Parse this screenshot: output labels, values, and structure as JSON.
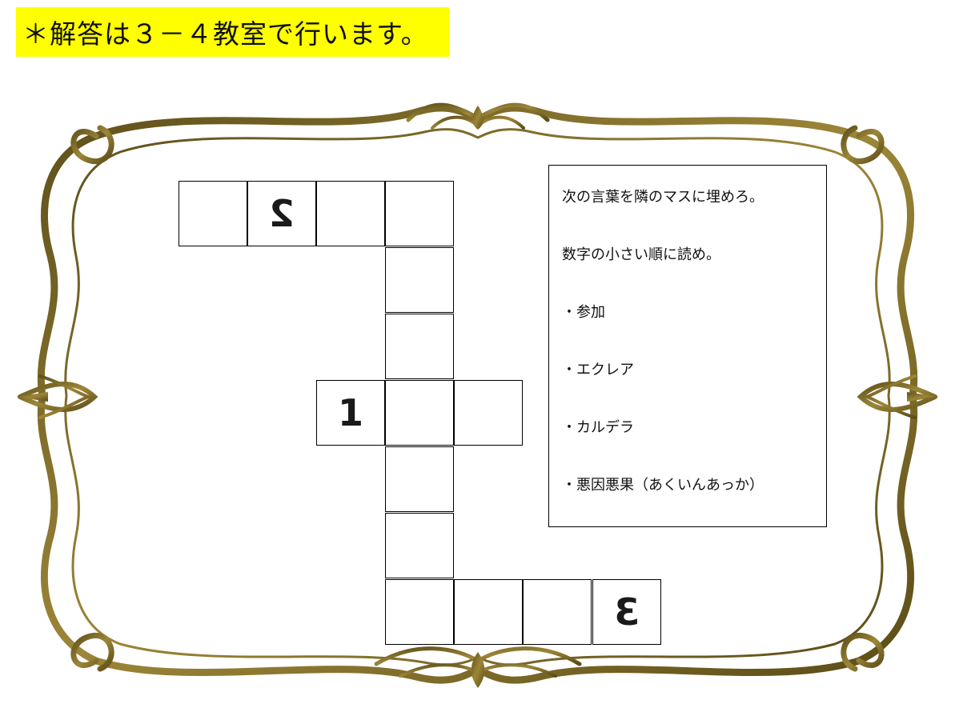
{
  "banner": {
    "text": "＊解答は３－４教室で行います。"
  },
  "frame": {
    "color": "#7a6722",
    "highlight": "#c9b35a"
  },
  "puzzle": {
    "clue_numbers": {
      "one": "1",
      "two": "2",
      "three": "3"
    }
  },
  "clues": {
    "instruction_1": "次の言葉を隣のマスに埋めろ。",
    "instruction_2": "数字の小さい順に読め。",
    "items": [
      "・参加",
      "・エクレア",
      "・カルデラ",
      "・悪因悪果（あくいんあっか）"
    ]
  }
}
